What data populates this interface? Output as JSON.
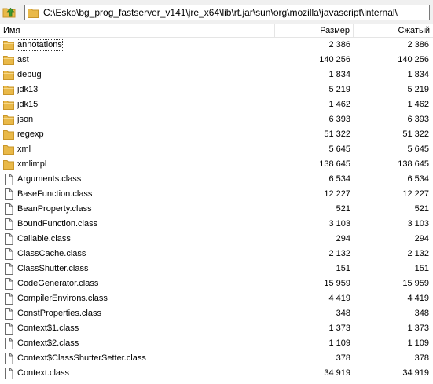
{
  "address": {
    "path": "C:\\Esko\\bg_prog_fastserver_v141\\jre_x64\\lib\\rt.jar\\sun\\org\\mozilla\\javascript\\internal\\"
  },
  "columns": {
    "name": "Имя",
    "size": "Размер",
    "packed": "Сжатый"
  },
  "colors": {
    "folder": "#e9b949",
    "folder_dark": "#c9962a",
    "file_border": "#6b6b6b",
    "up_arrow": "#3d9a2e"
  },
  "rows": [
    {
      "type": "folder",
      "name": "annotations",
      "size": "2 386",
      "packed": "2 386"
    },
    {
      "type": "folder",
      "name": "ast",
      "size": "140 256",
      "packed": "140 256"
    },
    {
      "type": "folder",
      "name": "debug",
      "size": "1 834",
      "packed": "1 834"
    },
    {
      "type": "folder",
      "name": "jdk13",
      "size": "5 219",
      "packed": "5 219"
    },
    {
      "type": "folder",
      "name": "jdk15",
      "size": "1 462",
      "packed": "1 462"
    },
    {
      "type": "folder",
      "name": "json",
      "size": "6 393",
      "packed": "6 393"
    },
    {
      "type": "folder",
      "name": "regexp",
      "size": "51 322",
      "packed": "51 322"
    },
    {
      "type": "folder",
      "name": "xml",
      "size": "5 645",
      "packed": "5 645"
    },
    {
      "type": "folder",
      "name": "xmlimpl",
      "size": "138 645",
      "packed": "138 645"
    },
    {
      "type": "file",
      "name": "Arguments.class",
      "size": "6 534",
      "packed": "6 534"
    },
    {
      "type": "file",
      "name": "BaseFunction.class",
      "size": "12 227",
      "packed": "12 227"
    },
    {
      "type": "file",
      "name": "BeanProperty.class",
      "size": "521",
      "packed": "521"
    },
    {
      "type": "file",
      "name": "BoundFunction.class",
      "size": "3 103",
      "packed": "3 103"
    },
    {
      "type": "file",
      "name": "Callable.class",
      "size": "294",
      "packed": "294"
    },
    {
      "type": "file",
      "name": "ClassCache.class",
      "size": "2 132",
      "packed": "2 132"
    },
    {
      "type": "file",
      "name": "ClassShutter.class",
      "size": "151",
      "packed": "151"
    },
    {
      "type": "file",
      "name": "CodeGenerator.class",
      "size": "15 959",
      "packed": "15 959"
    },
    {
      "type": "file",
      "name": "CompilerEnvirons.class",
      "size": "4 419",
      "packed": "4 419"
    },
    {
      "type": "file",
      "name": "ConstProperties.class",
      "size": "348",
      "packed": "348"
    },
    {
      "type": "file",
      "name": "Context$1.class",
      "size": "1 373",
      "packed": "1 373"
    },
    {
      "type": "file",
      "name": "Context$2.class",
      "size": "1 109",
      "packed": "1 109"
    },
    {
      "type": "file",
      "name": "Context$ClassShutterSetter.class",
      "size": "378",
      "packed": "378"
    },
    {
      "type": "file",
      "name": "Context.class",
      "size": "34 919",
      "packed": "34 919"
    }
  ]
}
